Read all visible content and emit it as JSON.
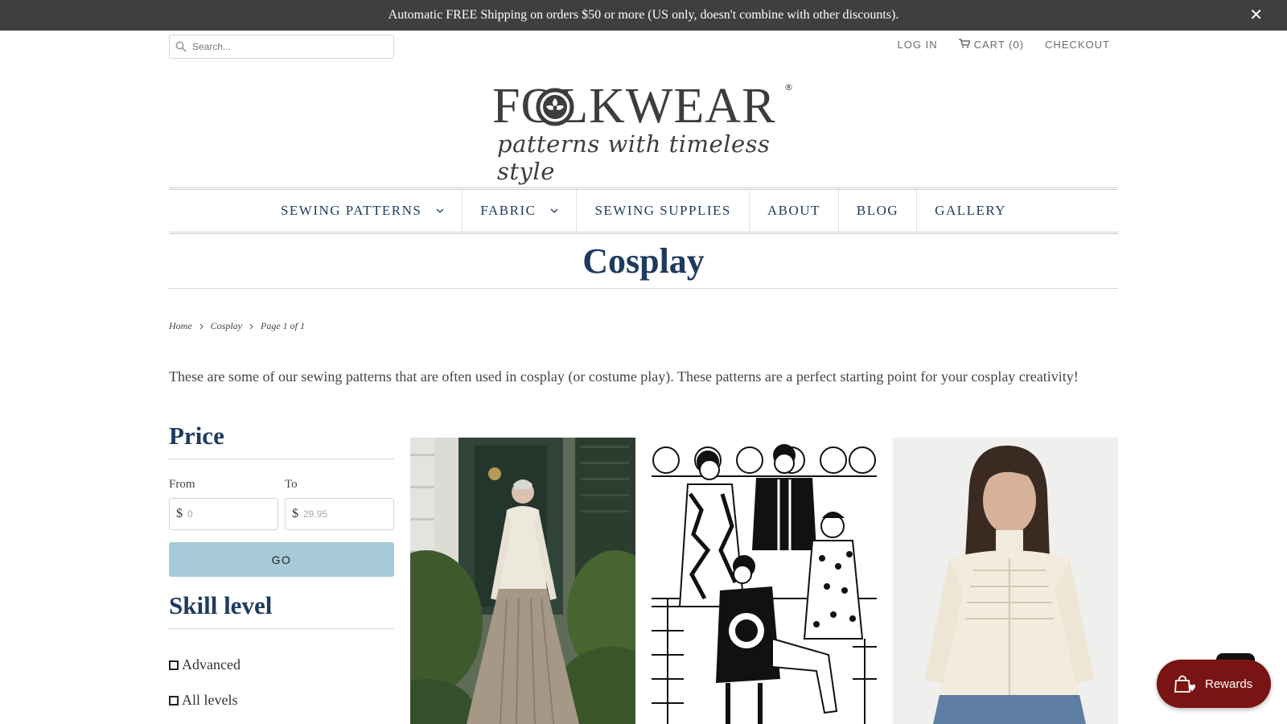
{
  "announcement": {
    "text": "Automatic FREE Shipping on orders $50 or more (US only, doesn't combine with other discounts).",
    "close_icon": "close-icon"
  },
  "search": {
    "placeholder": "Search..."
  },
  "utility_links": {
    "login": "LOG IN",
    "cart": "CART (0)",
    "checkout": "CHECKOUT"
  },
  "logo": {
    "wordmark": "FOLKWEAR",
    "registered": "®",
    "tagline": "patterns with timeless style"
  },
  "nav": {
    "items": [
      {
        "label": "SEWING PATTERNS",
        "has_dropdown": true
      },
      {
        "label": "FABRIC",
        "has_dropdown": true
      },
      {
        "label": "SEWING SUPPLIES",
        "has_dropdown": false
      },
      {
        "label": "ABOUT",
        "has_dropdown": false
      },
      {
        "label": "BLOG",
        "has_dropdown": false
      },
      {
        "label": "GALLERY",
        "has_dropdown": false
      }
    ]
  },
  "page": {
    "title": "Cosplay",
    "breadcrumb": [
      "Home",
      "Cosplay",
      "Page 1 of 1"
    ],
    "description": "These are some of our sewing patterns that are often used in cosplay (or costume play).  These patterns are a perfect starting point for your cosplay creativity!"
  },
  "filters": {
    "price": {
      "heading": "Price",
      "from_label": "From",
      "to_label": "To",
      "currency": "$",
      "from_placeholder": "0",
      "to_placeholder": "29.95",
      "go_label": "GO"
    },
    "skill": {
      "heading": "Skill level",
      "options": [
        "Advanced",
        "All levels"
      ]
    }
  },
  "rewards": {
    "label": "Rewards"
  },
  "colors": {
    "announcement_bg": "#3f3f3f",
    "brand_navy": "#1e3a5f",
    "go_button": "#a7cad8",
    "rewards_bg": "#7a1313"
  }
}
